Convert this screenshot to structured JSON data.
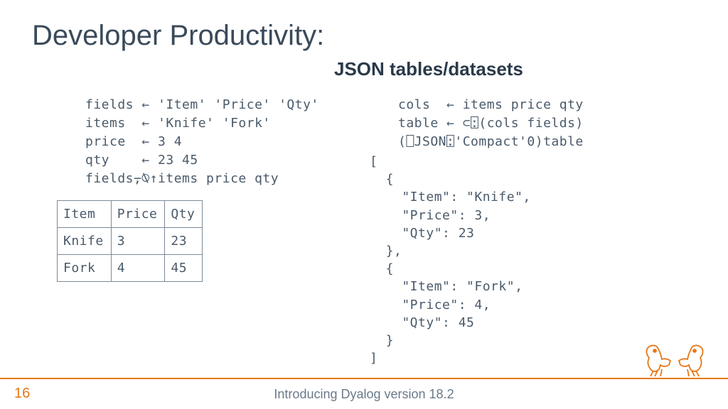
{
  "title": "Developer Productivity:",
  "subtitle": "JSON tables/datasets",
  "code_left": "fields ← 'Item' 'Price' 'Qty'\nitems  ← 'Knife' 'Fork'\nprice  ← 3 4\nqty    ← 23 45\nfields⍪⍉↑items price qty",
  "table": {
    "headers": [
      "Item",
      "Price",
      "Qty"
    ],
    "rows": [
      [
        "Knife",
        "3",
        "23"
      ],
      [
        "Fork",
        "4",
        "45"
      ]
    ]
  },
  "code_right": "cols  ← items price qty\ntable ← ⊂⍠(cols fields)\n(⎕JSON⍠'Compact'0)table",
  "json_output": "[\n  {\n    \"Item\": \"Knife\",\n    \"Price\": 3,\n    \"Qty\": 23\n  },\n  {\n    \"Item\": \"Fork\",\n    \"Price\": 4,\n    \"Qty\": 45\n  }\n]",
  "footer": {
    "page": "16",
    "text": "Introducing Dyalog version 18.2"
  }
}
